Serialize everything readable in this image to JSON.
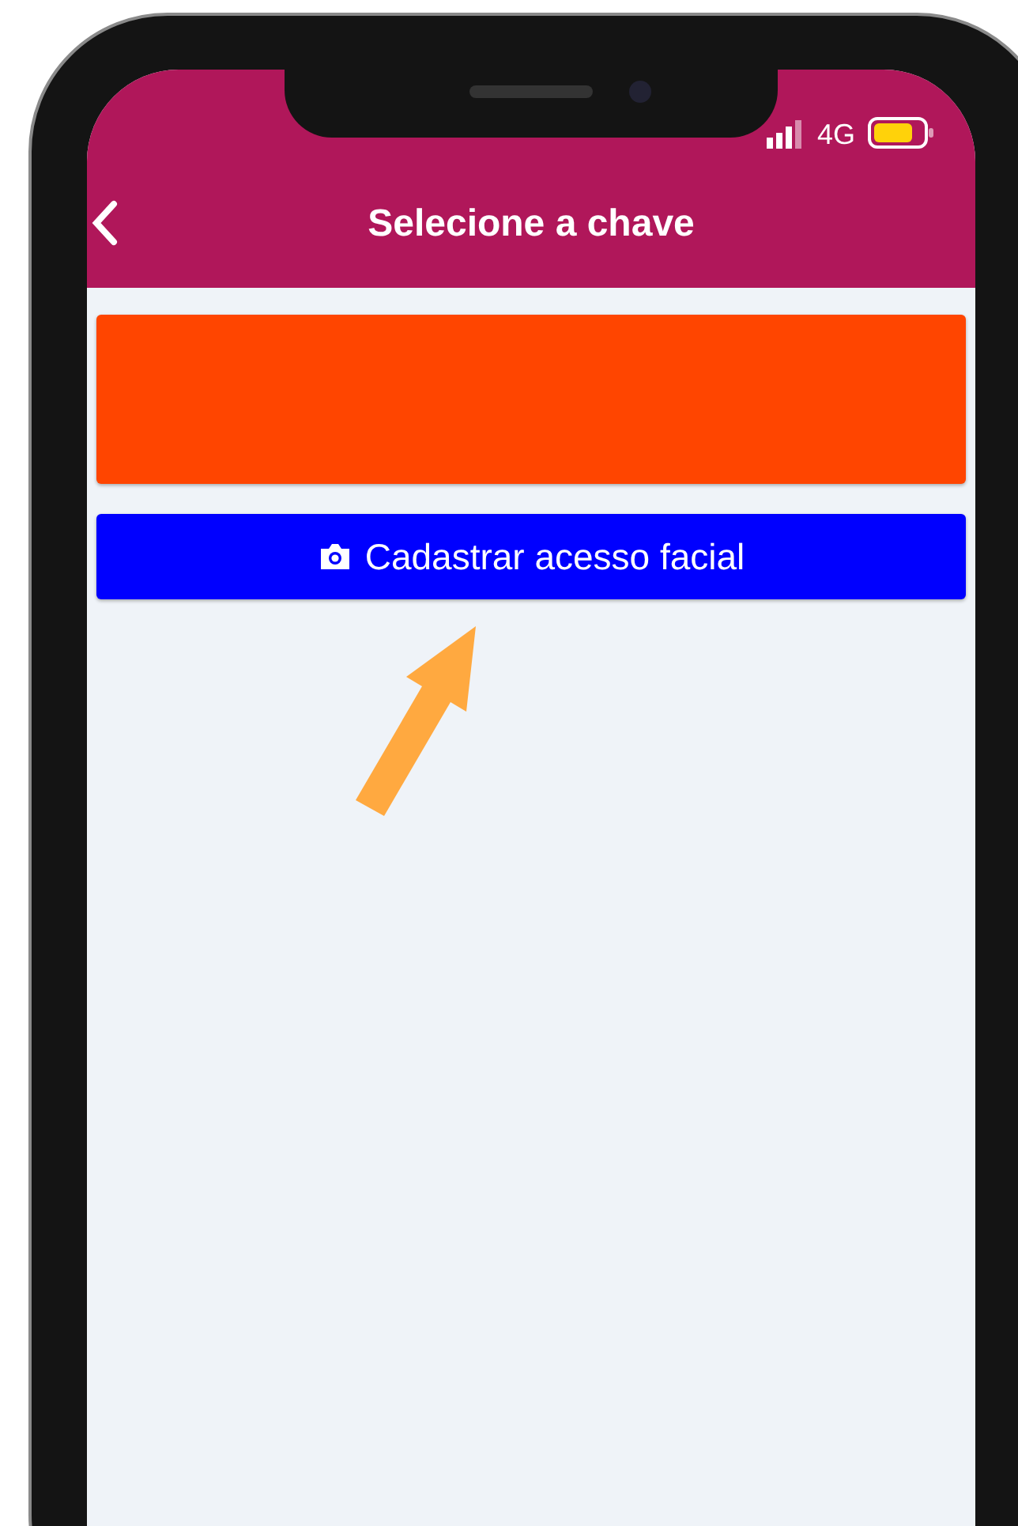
{
  "status_bar": {
    "network": "4G"
  },
  "header": {
    "title": "Selecione a chave"
  },
  "items": [
    {
      "kind": "banner"
    },
    {
      "kind": "action",
      "label": "Cadastrar acesso facial"
    }
  ]
}
